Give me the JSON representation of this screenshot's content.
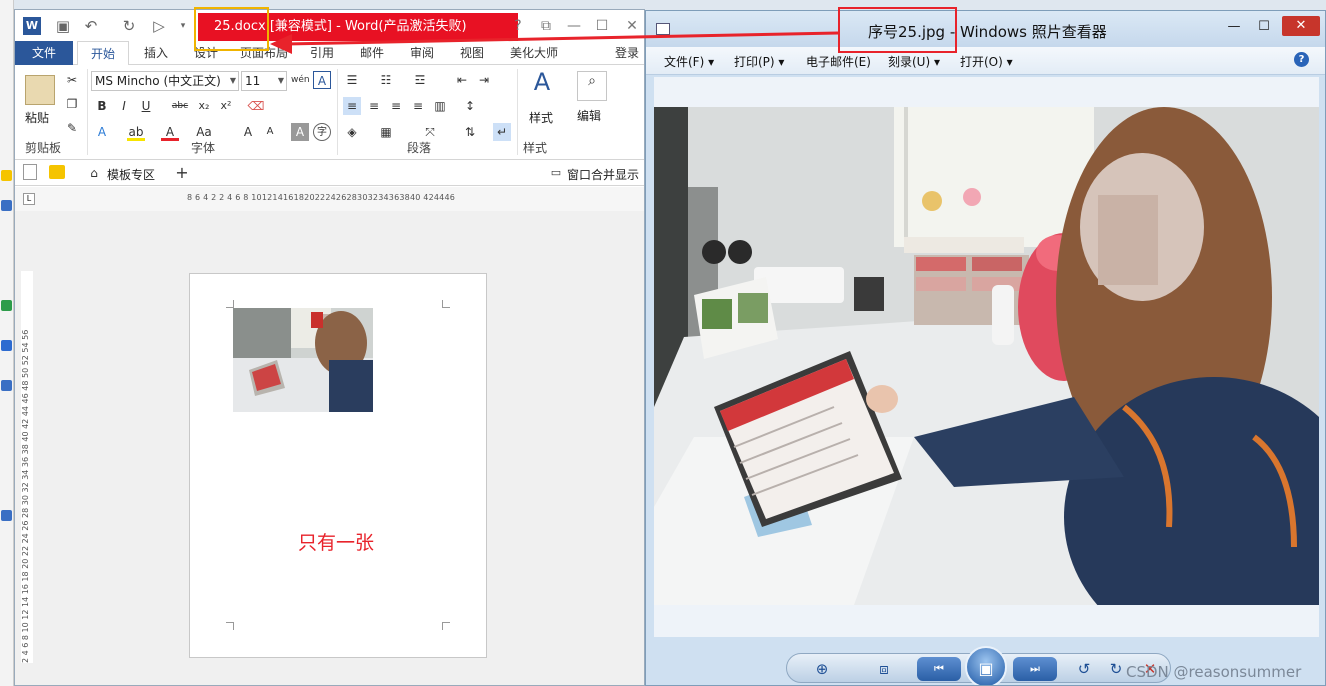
{
  "word": {
    "title": "25.docx [兼容模式] -  Word(产品激活失败)",
    "logo": "W",
    "tabs": [
      "文件",
      "开始",
      "插入",
      "设计",
      "页面布局",
      "引用",
      "邮件",
      "审阅",
      "视图",
      "美化大师",
      "登录"
    ],
    "window_controls": [
      "?",
      "⧉",
      "—",
      "☐",
      "✕"
    ],
    "ribbon": {
      "font_name": "MS Mincho (中文正文)",
      "font_size": "11",
      "paste_label": "粘贴",
      "styles_label": "样式",
      "edit_label": "编辑",
      "groups": [
        "剪贴板",
        "字体",
        "段落",
        "样式"
      ]
    },
    "tabbar": {
      "templates": "模板专区",
      "merge_display": "窗口合并显示"
    },
    "ruler_h": "8 6 4 2   2 4 6 8 10121416182022242628303234363840 424446",
    "ruler_v": "2 4 6 8 10 12 14 16 18 20 22 24 26 28 30 32 34 36 38 40 42 44 46 48 50 52 54 56",
    "note": "只有一张"
  },
  "viewer": {
    "title": "序号25.jpg - Windows 照片查看器",
    "menu": [
      "文件(F)",
      "打印(P)",
      "电子邮件(E)",
      "刻录(U)",
      "打开(O)"
    ],
    "help": "?",
    "watermark": "CSDN @reasonsummer"
  }
}
